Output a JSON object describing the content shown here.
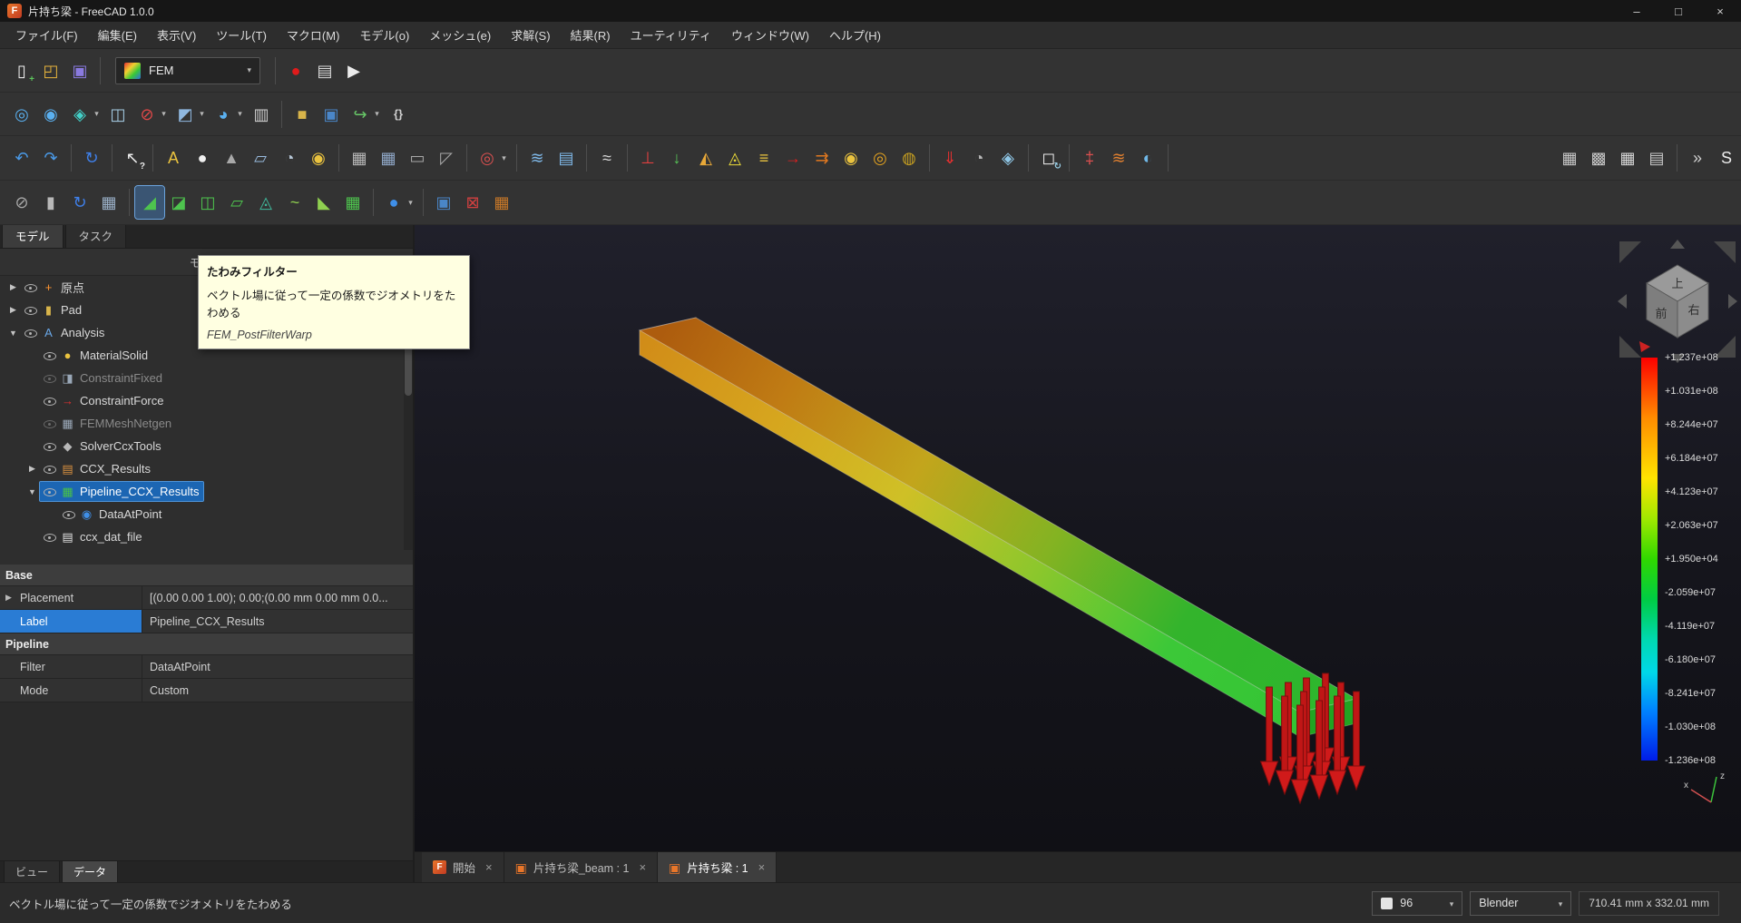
{
  "colors": {
    "selection_blue": "#1c66b3",
    "property_selected_blue": "#2a7cd4",
    "tooltip_bg": "#ffffe1",
    "toolbar_bg": "#333333",
    "viewport_bg": "#15151c",
    "beam_far_color": "#ad5c0e",
    "beam_near_color": "#2db72d",
    "force_arrow_red": "#c01616"
  },
  "window": {
    "app_icon": "F",
    "title": "片持ち梁 - FreeCAD 1.0.0",
    "minimize": "–",
    "maximize": "□",
    "close": "×"
  },
  "menu": [
    "ファイル(F)",
    "編集(E)",
    "表示(V)",
    "ツール(T)",
    "マクロ(M)",
    "モデル(o)",
    "メッシュ(e)",
    "求解(S)",
    "結果(R)",
    "ユーティリティ",
    "ウィンドウ(W)",
    "ヘルプ(H)"
  ],
  "toolbars": {
    "workbench": {
      "selected": "FEM"
    },
    "file": [
      {
        "name": "new-document",
        "glyph": "▯",
        "color": "#f2f2f2",
        "glyph2": "+",
        "color2": "#5dc85d"
      },
      {
        "name": "open-document",
        "glyph": "◰",
        "color": "#e4b23c"
      },
      {
        "name": "save-document",
        "glyph": "▣",
        "color": "#8a7ae0"
      }
    ],
    "macro": [
      {
        "name": "macro-record",
        "glyph": "●",
        "color": "#e01b1b"
      },
      {
        "name": "macro-dialog",
        "glyph": "▤",
        "color": "#d8d8d8"
      },
      {
        "name": "macro-execute",
        "glyph": "▶",
        "color": "#ececec"
      }
    ],
    "view": [
      {
        "name": "zoom-fit-all",
        "glyph": "◎",
        "color": "#5ab0f0"
      },
      {
        "name": "zoom-selection",
        "glyph": "◉",
        "color": "#5ab0f0"
      },
      {
        "name": "view-isometric",
        "glyph": "◈",
        "color": "#43d1c9",
        "dropdown": true
      },
      {
        "name": "view-align",
        "glyph": "◫",
        "color": "#a8d0e8"
      },
      {
        "name": "draw-style",
        "glyph": "⊘",
        "color": "#e04848",
        "dropdown": true
      },
      {
        "name": "view-appearance",
        "glyph": "◩",
        "color": "#90b8e0",
        "dropdown": true
      },
      {
        "name": "zoom-tools",
        "glyph": "◕",
        "color": "#5ab0f0",
        "dropdown": true
      },
      {
        "name": "measurement",
        "glyph": "▥",
        "color": "#cfcfcf"
      },
      {
        "sep": true
      },
      {
        "name": "create-part",
        "glyph": "■",
        "color": "#d8b44a"
      },
      {
        "name": "create-group",
        "glyph": "▣",
        "color": "#4a86c8"
      },
      {
        "name": "make-link",
        "glyph": "↪",
        "color": "#68c868",
        "dropdown": true
      },
      {
        "name": "expression-editor",
        "glyph": "{}",
        "color": "#d0d0d0",
        "small": true
      }
    ],
    "model": [
      {
        "name": "undo",
        "glyph": "↶",
        "color": "#4a9ae8"
      },
      {
        "name": "redo",
        "glyph": "↷",
        "color": "#4a9ae8"
      },
      {
        "sep": true
      },
      {
        "name": "refresh",
        "glyph": "↻",
        "color": "#3f7fe8"
      },
      {
        "sep": true
      },
      {
        "name": "whats-this",
        "glyph": "↖",
        "color": "#ececec",
        "glyph2": "?",
        "color2": "#ececec"
      },
      {
        "sep": true
      },
      {
        "name": "create-analysis",
        "glyph": "A",
        "color": "#eac33f"
      },
      {
        "name": "material-solid",
        "glyph": "●",
        "color": "#f0f0f0"
      },
      {
        "name": "material-fluid",
        "glyph": "▲",
        "color": "#a8a8a8"
      },
      {
        "name": "element-geometry",
        "glyph": "▱",
        "color": "#9abce0"
      },
      {
        "name": "element-rotation",
        "glyph": "◔",
        "color": "#b8c8d8"
      },
      {
        "name": "material-editor",
        "glyph": "◉",
        "color": "#eac33f"
      },
      {
        "sep": true
      },
      {
        "name": "mesh-netgen",
        "glyph": "▦",
        "color": "#b8b8b8"
      },
      {
        "name": "mesh-gmsh",
        "glyph": "▦",
        "color": "#90a8c8"
      },
      {
        "name": "mesh-region",
        "glyph": "▭",
        "color": "#a8a8a8"
      },
      {
        "name": "mesh-group",
        "glyph": "◸",
        "color": "#a8a8a8"
      },
      {
        "sep": true
      },
      {
        "name": "equations",
        "glyph": "◎",
        "color": "#d85050",
        "dropdown": true
      },
      {
        "sep": true
      },
      {
        "name": "element-fluid-1d",
        "glyph": "≋",
        "color": "#7fb8e8"
      },
      {
        "name": "element-shell-thickness",
        "glyph": "▤",
        "color": "#7fb8e8"
      },
      {
        "sep": true
      },
      {
        "name": "constraint-flow-velocity",
        "glyph": "≈",
        "color": "#d8d8d8"
      },
      {
        "sep": true
      },
      {
        "name": "constraint-fixed",
        "glyph": "⊥",
        "color": "#e04040"
      },
      {
        "name": "constraint-displacement",
        "glyph": "↓",
        "color": "#58c858"
      },
      {
        "name": "constraint-contact",
        "glyph": "◭",
        "color": "#e8a838"
      },
      {
        "name": "constraint-tie",
        "glyph": "◬",
        "color": "#e8d838"
      },
      {
        "name": "constraint-spring",
        "glyph": "≡",
        "color": "#eac33f"
      },
      {
        "name": "constraint-force",
        "glyph": "→",
        "color": "#e02020"
      },
      {
        "name": "constraint-pressure",
        "glyph": "⇉",
        "color": "#e07820"
      },
      {
        "name": "constraint-bearing",
        "glyph": "◉",
        "color": "#eac33f"
      },
      {
        "name": "constraint-gear",
        "glyph": "◎",
        "color": "#e0a020"
      },
      {
        "name": "constraint-pulley",
        "glyph": "◍",
        "color": "#c8a020"
      },
      {
        "sep": true
      },
      {
        "name": "constraint-self-weight",
        "glyph": "⇓",
        "color": "#e03030"
      },
      {
        "name": "constraint-centrifugal",
        "glyph": "◔",
        "color": "#b8b8b8"
      },
      {
        "name": "constraint-generic",
        "glyph": "◈",
        "color": "#90c8e8"
      },
      {
        "sep": true
      },
      {
        "name": "constraint-transform",
        "glyph": "◻",
        "color": "#ececec",
        "glyph2": "↻",
        "color2": "#9ad0e8"
      },
      {
        "sep": true
      },
      {
        "name": "constraint-temperature",
        "glyph": "‡",
        "color": "#e05050"
      },
      {
        "name": "constraint-heatflux",
        "glyph": "≋",
        "color": "#e08030"
      },
      {
        "name": "constraint-initial-temperature",
        "glyph": "◐",
        "color": "#70b8e8"
      },
      {
        "sep": true
      },
      {
        "name": "mesh-display-faces",
        "glyph": "▦",
        "color": "#c8c8c8",
        "push": true
      },
      {
        "name": "mesh-display-wireframe",
        "glyph": "▩",
        "color": "#c8c8c8"
      },
      {
        "name": "mesh-display-nodes",
        "glyph": "▦",
        "color": "#d8d8d8"
      },
      {
        "name": "mesh-display-elements",
        "glyph": "▤",
        "color": "#c8c8c8"
      },
      {
        "sep": true
      },
      {
        "name": "toolbar-overflow",
        "glyph": "»",
        "color": "#d0d0d0"
      },
      {
        "name": "std-views",
        "glyph": "S",
        "color": "#ececec"
      }
    ],
    "post": [
      {
        "name": "post-sphere-cut",
        "glyph": "⊘",
        "color": "#a8a8a8"
      },
      {
        "name": "post-cylinder-cut",
        "glyph": "▮",
        "color": "#b8b8b8"
      },
      {
        "name": "recompute-pipeline",
        "glyph": "↻",
        "color": "#3f7fe8"
      },
      {
        "name": "post-data-table",
        "glyph": "▦",
        "color": "#9ab0c8"
      },
      {
        "sep": true
      },
      {
        "name": "warp-filter",
        "glyph": "◢",
        "color": "#4ec44e",
        "active": true
      },
      {
        "name": "clip-filter",
        "glyph": "◪",
        "color": "#4ec44e"
      },
      {
        "name": "scalar-clip-filter",
        "glyph": "◫",
        "color": "#4ec44e"
      },
      {
        "name": "cut-function-filter",
        "glyph": "▱",
        "color": "#4ec44e"
      },
      {
        "name": "contours-filter",
        "glyph": "◬",
        "color": "#3fb89a"
      },
      {
        "name": "data-along-line",
        "glyph": "~",
        "color": "#8fd050"
      },
      {
        "name": "linearized-stresses",
        "glyph": "◣",
        "color": "#8fd050"
      },
      {
        "name": "pipeline-from-result",
        "glyph": "▦",
        "color": "#4ec44e"
      },
      {
        "sep": true
      },
      {
        "name": "post-functions",
        "glyph": "●",
        "color": "#3f8fe8",
        "dropdown": true
      },
      {
        "sep": true
      },
      {
        "name": "glyph-filter",
        "glyph": "▣",
        "color": "#4a86c8"
      },
      {
        "name": "delete-results",
        "glyph": "⊠",
        "color": "#d04040"
      },
      {
        "name": "colored-mesh",
        "glyph": "▦",
        "color": "#c87828"
      }
    ]
  },
  "combo_view": {
    "tabs": [
      {
        "label": "モデル",
        "active": true
      },
      {
        "label": "タスク"
      }
    ],
    "tree_header": "モデル",
    "tree": [
      {
        "name": "origin",
        "label": "原点",
        "depth": 0,
        "expander": "collapsed",
        "glyph": "+",
        "color": "#ff9430"
      },
      {
        "name": "pad",
        "label": "Pad",
        "depth": 0,
        "expander": "collapsed",
        "glyph": "▮",
        "color": "#d8b44a"
      },
      {
        "name": "analysis",
        "label": "Analysis",
        "depth": 0,
        "expander": "expanded",
        "glyph": "A",
        "color": "#6aa8e8"
      },
      {
        "name": "material-solid",
        "label": "MaterialSolid",
        "depth": 1,
        "glyph": "●",
        "color": "#eac33f"
      },
      {
        "name": "constraint-fixed",
        "label": "ConstraintFixed",
        "depth": 1,
        "glyph": "◨",
        "color": "#9aa8b8",
        "dimmed": true
      },
      {
        "name": "constraint-force",
        "label": "ConstraintForce",
        "depth": 1,
        "glyph": "→",
        "color": "#e03030"
      },
      {
        "name": "fem-mesh-netgen",
        "label": "FEMMeshNetgen",
        "depth": 1,
        "glyph": "▦",
        "color": "#9aa8b8",
        "dimmed": true
      },
      {
        "name": "solver-ccx-tools",
        "label": "SolverCcxTools",
        "depth": 1,
        "glyph": "◆",
        "color": "#b8b8b8"
      },
      {
        "name": "ccx-results",
        "label": "CCX_Results",
        "depth": 1,
        "expander": "collapsed",
        "glyph": "▤",
        "color": "#d89040"
      },
      {
        "name": "pipeline-ccx-results",
        "label": "Pipeline_CCX_Results",
        "depth": 1,
        "expander": "expanded",
        "glyph": "▦",
        "color": "#48c048",
        "selected": true
      },
      {
        "name": "data-at-point",
        "label": "DataAtPoint",
        "depth": 2,
        "glyph": "◉",
        "color": "#3f8fe8"
      },
      {
        "name": "ccx-dat-file",
        "label": "ccx_dat_file",
        "depth": 1,
        "glyph": "▤",
        "color": "#e0e0e0"
      }
    ],
    "property_groups": [
      {
        "group": "Base",
        "rows": [
          {
            "name": "Placement",
            "value": "[(0.00 0.00 1.00); 0.00;(0.00 mm  0.00 mm  0.0...",
            "expandable": true
          },
          {
            "name": "Label",
            "value": "Pipeline_CCX_Results",
            "selected": true
          }
        ]
      },
      {
        "group": "Pipeline",
        "rows": [
          {
            "name": "Filter",
            "value": "DataAtPoint"
          },
          {
            "name": "Mode",
            "value": "Custom"
          }
        ]
      }
    ],
    "bottom_tabs": [
      {
        "label": "ビュー"
      },
      {
        "label": "データ",
        "active": true
      }
    ]
  },
  "tooltip": {
    "title": "たわみフィルター",
    "description": "ベクトル場に従って一定の係数でジオメトリをたわめる",
    "command": "FEM_PostFilterWarp"
  },
  "viewport": {
    "legend_values": [
      "+1.237e+08",
      "+1.031e+08",
      "+8.244e+07",
      "+6.184e+07",
      "+4.123e+07",
      "+2.063e+07",
      "+1.950e+04",
      "-2.059e+07",
      "-4.119e+07",
      "-6.180e+07",
      "-8.241e+07",
      "-1.030e+08",
      "-1.236e+08"
    ],
    "nav_cube": {
      "top": "上",
      "front": "前",
      "right": "右"
    },
    "axes": {
      "x": "x",
      "z": "z"
    }
  },
  "mdi_tabs": [
    {
      "label": "開始",
      "icon": "freecad",
      "icon_text": "F",
      "close": "×"
    },
    {
      "label": "片持ち梁_beam : 1",
      "icon": "document",
      "close": "×"
    },
    {
      "label": "片持ち梁 : 1",
      "icon": "document",
      "close": "×",
      "active": true
    }
  ],
  "status": {
    "message": "ベクトル場に従って一定の係数でジオメトリをたわめる",
    "scale_value": "96",
    "nav_style": "Blender",
    "view_size": "710.41 mm x 332.01 mm"
  }
}
